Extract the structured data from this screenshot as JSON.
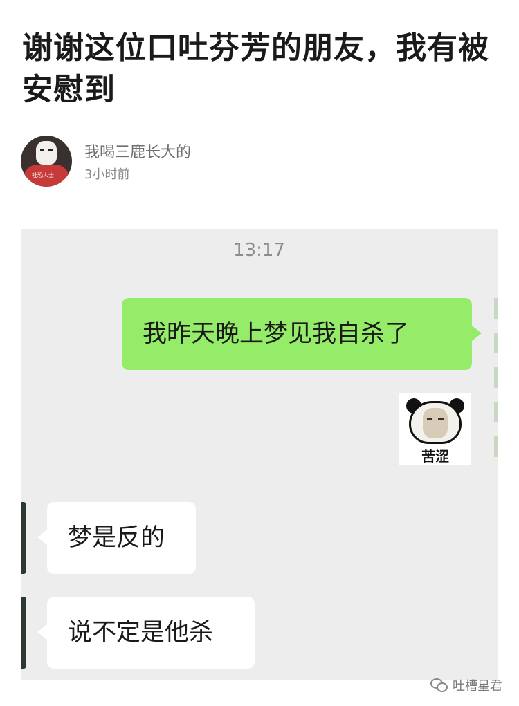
{
  "post": {
    "title": "谢谢这位口吐芬芳的朋友，我有被安慰到",
    "author": "我喝三鹿长大的",
    "time": "3小时前",
    "avatar_tag": "社恐人士"
  },
  "chat": {
    "timestamp": "13:17",
    "messages": [
      {
        "side": "out",
        "text": "我昨天晚上梦见我自杀了"
      },
      {
        "side": "out",
        "type": "sticker",
        "caption": "苦涩"
      },
      {
        "side": "in",
        "text": "梦是反的"
      },
      {
        "side": "in",
        "text": "说不定是他杀"
      }
    ]
  },
  "watermark": {
    "text": "吐槽星君",
    "icon": "wechat-icon"
  },
  "colors": {
    "outgoing_bubble": "#95ec69",
    "incoming_bubble": "#ffffff",
    "chat_background": "#ededed"
  }
}
